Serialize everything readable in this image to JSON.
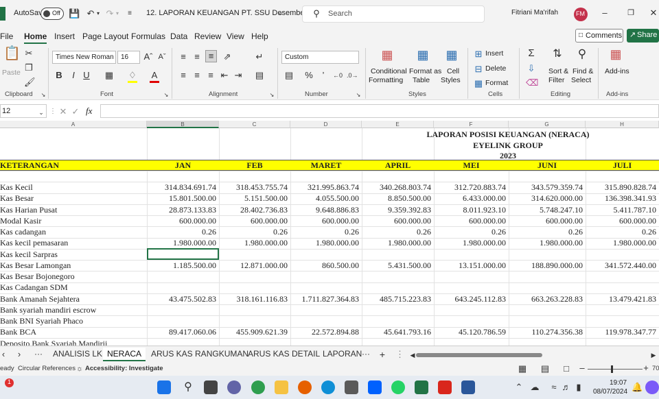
{
  "titlebar": {
    "autosave_label": "AutoSave",
    "autosave_state": "Off",
    "doc_title": "12. LAPORAN KEUANGAN PT. SSU Desembe...",
    "search_placeholder": "Search",
    "user_name": "Fitriani Ma'rifah",
    "user_initials": "FM"
  },
  "menu": {
    "items": [
      "File",
      "Home",
      "Insert",
      "Page Layout",
      "Formulas",
      "Data",
      "Review",
      "View",
      "Help"
    ],
    "comments": "Comments",
    "share": "Share"
  },
  "ribbon": {
    "paste": "Paste",
    "clipboard": "Clipboard",
    "font_name": "Times New Roman",
    "font_size": "16",
    "font": "Font",
    "alignment": "Alignment",
    "number_format": "Custom",
    "number": "Number",
    "conditional_formatting": [
      "Conditional",
      "Formatting"
    ],
    "format_as_table": [
      "Format as",
      "Table"
    ],
    "cell_styles": [
      "Cell",
      "Styles"
    ],
    "styles": "Styles",
    "insert": "Insert",
    "delete": "Delete",
    "format": "Format",
    "cells": "Cells",
    "sort_filter": [
      "Sort &",
      "Filter"
    ],
    "find_select": [
      "Find &",
      "Select"
    ],
    "editing": "Editing",
    "addins": "Add-ins",
    "addins_group": "Add-ins"
  },
  "formula_bar": {
    "name_box": "12",
    "fx": "fx"
  },
  "sheet": {
    "columns": [
      "A",
      "B",
      "C",
      "D",
      "E",
      "F",
      "G",
      "H"
    ],
    "title1": "LAPORAN POSISI KEUANGAN (NERACA)",
    "title2": "EYELINK GROUP",
    "title3": "2023",
    "header": [
      "KETERANGAN",
      "JAN",
      "FEB",
      "MARET",
      "APRIL",
      "MEI",
      "JUNI",
      "JULI"
    ],
    "rows": [
      {
        "label": "Kas Kecil",
        "values": [
          "314.834.691.74",
          "318.453.755.74",
          "321.995.863.74",
          "340.268.803.74",
          "312.720.883.74",
          "343.579.359.74",
          "315.890.828.74"
        ]
      },
      {
        "label": "Kas Besar",
        "values": [
          "15.801.500.00",
          "5.151.500.00",
          "4.055.500.00",
          "8.850.500.00",
          "6.433.000.00",
          "314.620.000.00",
          "136.398.341.93"
        ]
      },
      {
        "label": "Kas Harian Pusat",
        "values": [
          "28.873.133.83",
          "28.402.736.83",
          "9.648.886.83",
          "9.359.392.83",
          "8.011.923.10",
          "5.748.247.10",
          "5.411.787.10"
        ]
      },
      {
        "label": "Modal Kasir",
        "values": [
          "600.000.00",
          "600.000.00",
          "600.000.00",
          "600.000.00",
          "600.000.00",
          "600.000.00",
          "600.000.00"
        ]
      },
      {
        "label": "Kas cadangan",
        "values": [
          "0.26",
          "0.26",
          "0.26",
          "0.26",
          "0.26",
          "0.26",
          "0.26"
        ]
      },
      {
        "label": "Kas kecil pemasaran",
        "values": [
          "1.980.000.00",
          "1.980.000.00",
          "1.980.000.00",
          "1.980.000.00",
          "1.980.000.00",
          "1.980.000.00",
          "1.980.000.00"
        ]
      },
      {
        "label": "Kas kecil Sarpras",
        "values": [
          "",
          "",
          "",
          "",
          "",
          "",
          ""
        ]
      },
      {
        "label": "Kas Besar Lamongan",
        "values": [
          "1.185.500.00",
          "12.871.000.00",
          "860.500.00",
          "5.431.500.00",
          "13.151.000.00",
          "188.890.000.00",
          "341.572.440.00"
        ]
      },
      {
        "label": "Kas Besar Bojonegoro",
        "values": [
          "",
          "",
          "",
          "",
          "",
          "",
          ""
        ]
      },
      {
        "label": "Kas Cadangan SDM",
        "values": [
          "",
          "",
          "",
          "",
          "",
          "",
          ""
        ]
      },
      {
        "label": "Bank Amanah Sejahtera",
        "values": [
          "43.475.502.83",
          "318.161.116.83",
          "1.711.827.364.83",
          "485.715.223.83",
          "643.245.112.83",
          "663.263.228.83",
          "13.479.421.83"
        ]
      },
      {
        "label": "Bank syariah mandiri escrow",
        "values": [
          "",
          "",
          "",
          "",
          "",
          "",
          ""
        ]
      },
      {
        "label": "Bank BNI Syariah Phaco",
        "values": [
          "",
          "",
          "",
          "",
          "",
          "",
          ""
        ]
      },
      {
        "label": "Bank BCA",
        "values": [
          "89.417.060.06",
          "455.909.621.39",
          "22.572.894.88",
          "45.641.793.16",
          "45.120.786.59",
          "110.274.356.38",
          "119.978.347.77"
        ]
      },
      {
        "label": "Deposito Bank Syariah Mandirii",
        "values": [
          "",
          "",
          "",
          "",
          "",
          "",
          ""
        ]
      }
    ]
  },
  "tabs": {
    "items": [
      "ANALISIS LK",
      "NERACA",
      "ARUS KAS RANGKUMAN",
      "ARUS KAS DETAIL",
      "LAPORAN"
    ],
    "more": "···"
  },
  "status": {
    "ready": "eady",
    "circular": "Circular References",
    "accessibility": "Accessibility: Investigate",
    "zoom": "70"
  },
  "taskbar": {
    "time": "19:07",
    "date": "08/07/2024",
    "badge": "1"
  },
  "colors": {
    "excel_green": "#217346",
    "header_yellow": "#ffff00",
    "avatar": "#c4314b"
  }
}
